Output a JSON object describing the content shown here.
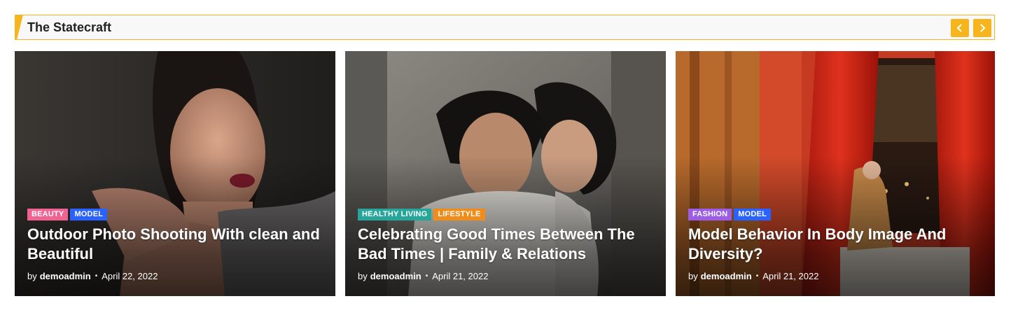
{
  "section": {
    "title": "The Statecraft",
    "accent_color": "#f6b51c",
    "prev_icon": "chevron-left-icon",
    "next_icon": "chevron-right-icon"
  },
  "cards": [
    {
      "tags": [
        {
          "label": "Beauty",
          "color": "#f06292"
        },
        {
          "label": "Model",
          "color": "#2962ff"
        }
      ],
      "title": "Outdoor Photo Shooting With clean and Beautiful",
      "by": "by",
      "author": "demoadmin",
      "date": "April 22, 2022"
    },
    {
      "tags": [
        {
          "label": "Healthy Living",
          "color": "#26a69a"
        },
        {
          "label": "Lifestyle",
          "color": "#ef8c1a"
        }
      ],
      "title": "Celebrating Good Times Between The Bad Times | Family & Relations",
      "by": "by",
      "author": "demoadmin",
      "date": "April 21, 2022"
    },
    {
      "tags": [
        {
          "label": "Fashion",
          "color": "#9c5ce6"
        },
        {
          "label": "Model",
          "color": "#2962ff"
        }
      ],
      "title": "Model Behavior In Body Image And Diversity?",
      "by": "by",
      "author": "demoadmin",
      "date": "April 21, 2022"
    }
  ]
}
